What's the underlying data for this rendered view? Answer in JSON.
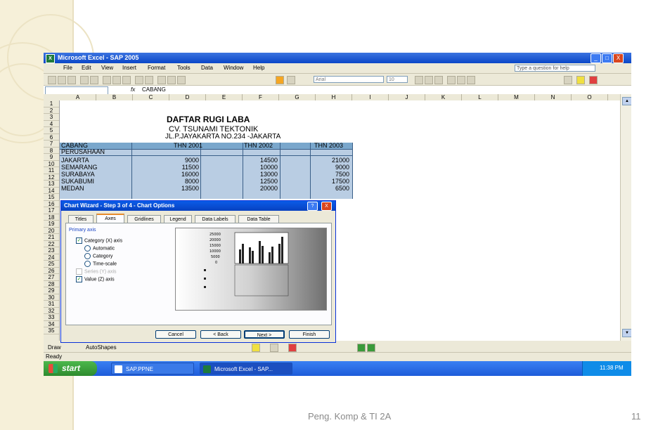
{
  "slide": {
    "footer_text": "Peng. Komp & TI 2A",
    "page_number": "11"
  },
  "excel": {
    "title": "Microsoft Excel - SAP 2005",
    "menu": [
      "File",
      "Edit",
      "View",
      "Insert",
      "Format",
      "Tools",
      "Data",
      "Window",
      "Help"
    ],
    "question_box_placeholder": "Type a question for help",
    "font_name": "Arial",
    "font_size": "10",
    "formula_bar": {
      "fx": "fx",
      "value": "CABANG"
    },
    "columns": [
      "A",
      "B",
      "C",
      "D",
      "E",
      "F",
      "G",
      "H",
      "I",
      "J",
      "K",
      "L",
      "M",
      "N",
      "O"
    ],
    "rows": [
      "1",
      "2",
      "3",
      "4",
      "5",
      "6",
      "7",
      "8",
      "9",
      "10",
      "11",
      "12",
      "13",
      "14",
      "15",
      "16",
      "17",
      "18",
      "19",
      "20",
      "21",
      "22",
      "23",
      "24",
      "25",
      "26",
      "27",
      "28",
      "29",
      "30",
      "31",
      "32",
      "33",
      "34",
      "35"
    ],
    "heading1": "DAFTAR RUGI LABA",
    "heading2": "CV. TSUNAMI TEKTONIK",
    "heading3": "JL.P.JAYAKARTA NO.234 -JAKARTA",
    "table": {
      "header_row1": [
        "CABANG",
        "THN 2001",
        "THN 2002",
        "THN 2003"
      ],
      "header_row2": [
        "PERUSAHAAN"
      ],
      "rows": [
        {
          "name": "JAKARTA",
          "v1": "9000",
          "v2": "14500",
          "v3": "21000"
        },
        {
          "name": "SEMARANG",
          "v1": "11500",
          "v2": "10000",
          "v3": "9000"
        },
        {
          "name": "SURABAYA",
          "v1": "16000",
          "v2": "13000",
          "v3": "7500"
        },
        {
          "name": "SUKABUMI",
          "v1": "8000",
          "v2": "12500",
          "v3": "17500"
        },
        {
          "name": "MEDAN",
          "v1": "13500",
          "v2": "20000",
          "v3": "6500"
        }
      ]
    },
    "draw_bar": {
      "draw": "Draw",
      "autoshapes": "AutoShapes"
    },
    "status": "Ready"
  },
  "dialog": {
    "title": "Chart Wizard - Step 3 of 4 - Chart Options",
    "help": "?",
    "close": "X",
    "tabs": [
      "Titles",
      "Axes",
      "Gridlines",
      "Legend",
      "Data Labels",
      "Data Table"
    ],
    "group_label": "Primary axis",
    "options": {
      "category_axis": "Category (X) axis",
      "automatic": "Automatic",
      "category": "Category",
      "timescale": "Time-scale",
      "series_axis": "Series (Y) axis",
      "value_axis": "Value (Z) axis"
    },
    "preview_ticks": [
      "25000",
      "20000",
      "15000",
      "10000",
      "5000",
      "0"
    ],
    "buttons": {
      "cancel": "Cancel",
      "back": "< Back",
      "next": "Next >",
      "finish": "Finish"
    }
  },
  "taskbar": {
    "start": "start",
    "tasks": [
      "SAP.PPNE",
      "Microsoft Excel - SAP..."
    ],
    "clock": "11:38 PM"
  }
}
